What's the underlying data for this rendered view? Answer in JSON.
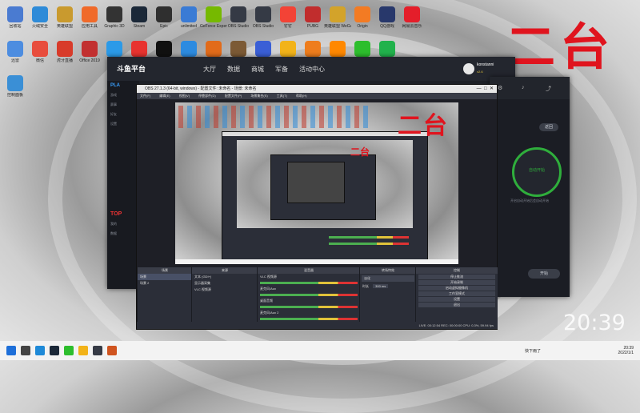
{
  "overlay_text": "二台",
  "desktop_icons": [
    {
      "label": "回收站",
      "color": "#4a7bd1"
    },
    {
      "label": "火绒安全",
      "color": "#2e8bd8"
    },
    {
      "label": "英雄联盟",
      "color": "#c99a2e"
    },
    {
      "label": "应用工具",
      "color": "#f06a2a"
    },
    {
      "label": "Graphic 3D",
      "color": "#333333"
    },
    {
      "label": "Steam",
      "color": "#1b2838"
    },
    {
      "label": "Epic",
      "color": "#2f2f2f"
    },
    {
      "label": "unlimited",
      "color": "#3a7bd5"
    },
    {
      "label": "GeForce Experience",
      "color": "#76b900"
    },
    {
      "label": "OBS Studio",
      "color": "#353a45"
    },
    {
      "label": "OBS Studio",
      "color": "#353a45"
    },
    {
      "label": "钉钉",
      "color": "#f34336"
    },
    {
      "label": "PUBG",
      "color": "#c12d2d"
    },
    {
      "label": "英雄联盟 WeGame版",
      "color": "#d3a32a"
    },
    {
      "label": "Origin",
      "color": "#f37b23"
    },
    {
      "label": "QQ游戏",
      "color": "#28386b"
    },
    {
      "label": "网易云音乐",
      "color": "#e41e2a"
    },
    {
      "label": "迅雷",
      "color": "#4d8de0"
    },
    {
      "label": "微信",
      "color": "#e84d3d"
    },
    {
      "label": "虎牙直播",
      "color": "#d83b2a"
    },
    {
      "label": "Office 2019",
      "color": "#c23030"
    },
    {
      "label": "QQ",
      "color": "#2b9ae8"
    },
    {
      "label": "斗鱼",
      "color": "#e8332f"
    },
    {
      "label": "网易UU",
      "color": "#111111"
    },
    {
      "label": "Chrome",
      "color": "#2d8be0"
    },
    {
      "label": "CS:GO",
      "color": "#e26b1a"
    },
    {
      "label": "美图",
      "color": "#7c5a35"
    },
    {
      "label": "Epic",
      "color": "#3a5fd6"
    },
    {
      "label": "网易",
      "color": "#f2b319"
    },
    {
      "label": "游戏",
      "color": "#ee7d1d"
    },
    {
      "label": "VLC",
      "color": "#ff8800"
    },
    {
      "label": "微信",
      "color": "#2dbe2d"
    },
    {
      "label": "QQ音乐",
      "color": "#21b24c"
    },
    {
      "label": "控制面板",
      "color": "#3a8fd6"
    }
  ],
  "game_platform": {
    "logo": "斗鱼平台",
    "nav": [
      "大厅",
      "数据",
      "商城",
      "军备",
      "活动中心"
    ],
    "user": "konstanni",
    "side_items": [
      "PLA",
      "游戏",
      "赛事",
      "好友",
      "设置",
      "TOP",
      "我的",
      "数据"
    ],
    "start_button": "自动开始",
    "tip": "开启自动开始后会自动开始",
    "button_top": "返回",
    "button_bottom": "开始",
    "version": "v2.6"
  },
  "obs": {
    "title": "OBS 27.1.3 (64-bit, windows) - 配置文件: 未命名 - 场景: 未命名",
    "menu": [
      "文件(F)",
      "编辑(E)",
      "视图(V)",
      "停靠部件(D)",
      "配置文件(P)",
      "场景集合(S)",
      "工具(T)",
      "帮助(H)"
    ],
    "docks": {
      "scenes": {
        "title": "场景",
        "items": [
          "场景",
          "场景 2"
        ]
      },
      "sources": {
        "title": "来源",
        "items": [
          "文本 (GDI+)",
          "显示器采集",
          "VLC 视频源"
        ]
      },
      "mixer": {
        "title": "混音器",
        "channels": [
          {
            "name": "VLC 视频源",
            "db": "0.0 dB"
          },
          {
            "name": "麦克风/Aux",
            "db": "0.0 dB"
          },
          {
            "name": "桌面音频",
            "db": "0.0 dB"
          },
          {
            "name": "麦克风/Aux 2",
            "db": "0.0 dB"
          }
        ]
      },
      "transitions": {
        "title": "转场特效",
        "type": "淡化",
        "duration_label": "时长",
        "duration": "300 ms"
      },
      "controls": {
        "title": "控制",
        "buttons": [
          "停止推流",
          "开始录制",
          "启动虚拟摄像机",
          "工作室模式",
          "设置",
          "退出"
        ]
      }
    },
    "status": "LIVE: 00:12:54   REC: 00:00:00   CPU: 0.3%, 59.94 fps"
  },
  "taskbar": {
    "time": "20:39",
    "date": "2022/1/1",
    "weather": "快下雨了",
    "icons": [
      {
        "name": "windows-start-icon",
        "color": "#1e6fd9"
      },
      {
        "name": "search-icon",
        "color": "#444444"
      },
      {
        "name": "edge-icon",
        "color": "#1f8ad8"
      },
      {
        "name": "steam-icon",
        "color": "#1b2838"
      },
      {
        "name": "wechat-icon",
        "color": "#2dbe2d"
      },
      {
        "name": "folder-icon",
        "color": "#f2b319"
      },
      {
        "name": "obs-icon",
        "color": "#353a45"
      },
      {
        "name": "game-icon",
        "color": "#d0541f"
      }
    ]
  },
  "clock_watermark": "20:39"
}
